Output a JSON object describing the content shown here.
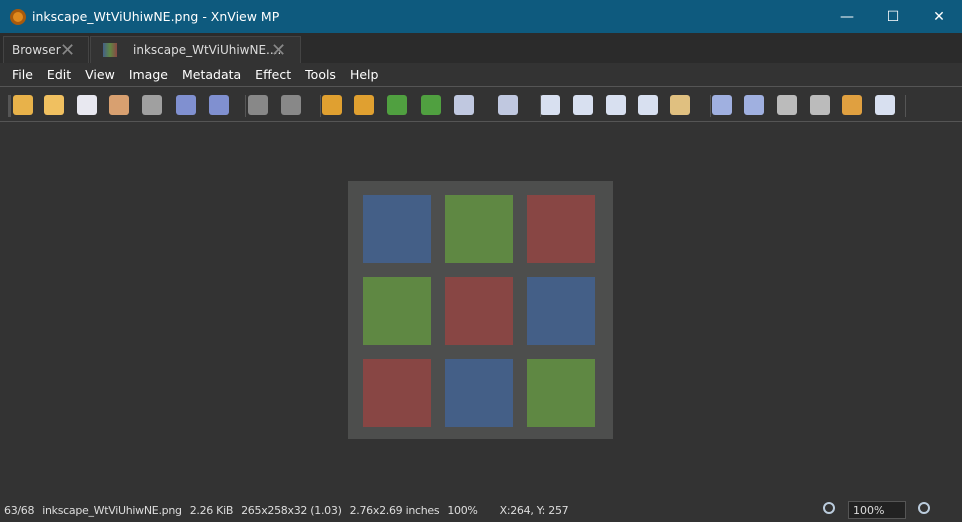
{
  "window": {
    "title": "inkscape_WtViUhiwNE.png - XnView MP",
    "minimize": "—",
    "maximize": "☐",
    "close": "✕"
  },
  "tabs": [
    {
      "label": "Browser"
    },
    {
      "label": "inkscape_WtViUhiwNE...."
    }
  ],
  "menu": [
    "File",
    "Edit",
    "View",
    "Image",
    "Metadata",
    "Effect",
    "Tools",
    "Help"
  ],
  "toolbar": [
    "browser-tree",
    "open-folder",
    "copy",
    "paste",
    "paste-new",
    "save",
    "save-as",
    "undo",
    "redo",
    "crop",
    "resize",
    "rotate-left",
    "rotate-right",
    "adjust",
    "levels",
    "zoom-in",
    "zoom-1to1",
    "zoom-out",
    "zoom-fit",
    "zoom-lock",
    "previous",
    "next",
    "first",
    "last",
    "slideshow",
    "properties"
  ],
  "image": {
    "colors": {
      "blue": "#445f87",
      "green": "#5f8843",
      "red": "#884644"
    },
    "grid": [
      [
        "blue",
        "green",
        "red"
      ],
      [
        "green",
        "red",
        "blue"
      ],
      [
        "red",
        "blue",
        "green"
      ]
    ]
  },
  "status": {
    "index": "63/68",
    "filename": "inkscape_WtViUhiwNE.png",
    "size": "2.26 KiB",
    "dims": "265x258x32 (1.03)",
    "inches": "2.76x2.69 inches",
    "zoom": "100%",
    "coords": "X:264, Y: 257",
    "zoom_field": "100%"
  }
}
